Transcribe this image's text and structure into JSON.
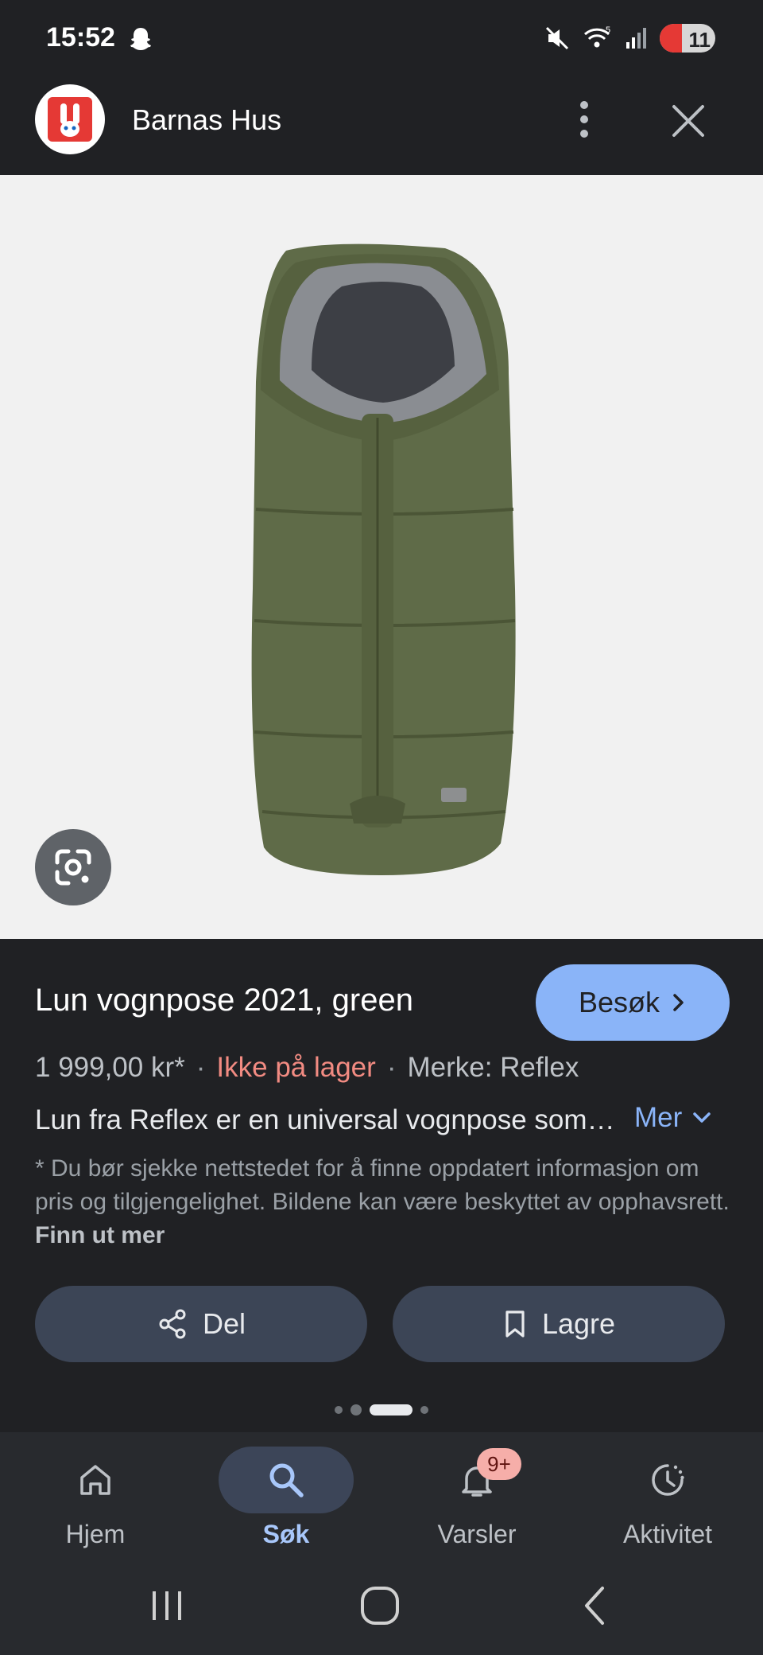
{
  "status_bar": {
    "time": "15:52",
    "battery": "11",
    "icons": [
      "snapchat-ghost-icon",
      "mute-icon",
      "wifi-icon",
      "signal-icon",
      "battery-icon"
    ]
  },
  "header": {
    "site_name": "Barnas Hus",
    "logo_icon": "barnas-hus-rabbit-logo",
    "more_icon": "more-vert-icon",
    "close_icon": "close-icon"
  },
  "image_viewer": {
    "lens_icon": "google-lens-icon",
    "background": "#f1f1f1"
  },
  "product": {
    "title": "Lun vognpose 2021, green",
    "visit_label": "Besøk",
    "price": "1 999,00 kr*",
    "separator": "·",
    "stock": "Ikke på lager",
    "brand": "Merke: Reflex",
    "description": "Lun fra Reflex er en universal vognpose som passer de fleste vogner",
    "more_label": "Mer",
    "disclaimer": "* Du bør sjekke nettstedet for å finne oppdatert informasjon om pris og tilgjengelighet. Bildene kan være beskyttet av opphavsrett.",
    "disclaimer_link": "Finn ut mer"
  },
  "actions": {
    "share_label": "Del",
    "save_label": "Lagre"
  },
  "pager": {
    "count": 4,
    "active_index": 2
  },
  "bottom_nav": {
    "items": [
      {
        "label": "Hjem",
        "icon": "home-icon",
        "active": false
      },
      {
        "label": "Søk",
        "icon": "search-icon",
        "active": true
      },
      {
        "label": "Varsler",
        "icon": "bell-icon",
        "active": false,
        "badge": "9+"
      },
      {
        "label": "Aktivitet",
        "icon": "activity-icon",
        "active": false
      }
    ]
  },
  "colors": {
    "accent": "#8ab4f8",
    "stock_warning": "#f28b82",
    "product_green": "#5f6b48"
  }
}
